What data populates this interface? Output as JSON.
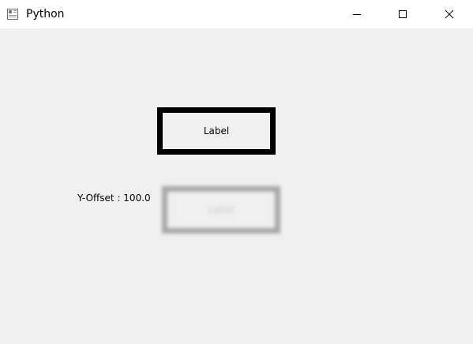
{
  "window": {
    "title": "Python",
    "icon": "python-app-icon",
    "controls": {
      "minimize": "minimize-icon",
      "maximize": "maximize-icon",
      "close": "close-icon"
    }
  },
  "main": {
    "label_text": "Label",
    "offset_text": "Y-Offset : 100.0",
    "shadow_label_text": "Label"
  },
  "colors": {
    "background": "#f0f0f0",
    "titlebar": "#ffffff",
    "label_border": "#000000",
    "shadow": "#a6a6a6"
  }
}
